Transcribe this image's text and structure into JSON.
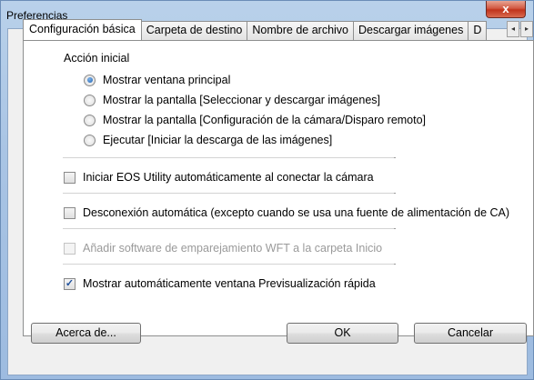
{
  "window": {
    "title": "Preferencias",
    "close_glyph": "x"
  },
  "tabs": [
    {
      "label": "Configuración básica"
    },
    {
      "label": "Carpeta de destino"
    },
    {
      "label": "Nombre de archivo"
    },
    {
      "label": "Descargar imágenes"
    },
    {
      "label": "D"
    }
  ],
  "tab_arrows": {
    "left": "◂",
    "right": "▸"
  },
  "initial_action": {
    "label": "Acción inicial",
    "options": [
      {
        "label": "Mostrar ventana principal",
        "selected": true
      },
      {
        "label": "Mostrar la pantalla [Seleccionar y descargar imágenes]",
        "selected": false
      },
      {
        "label": "Mostrar la pantalla [Configuración de la cámara/Disparo remoto]",
        "selected": false
      },
      {
        "label": "Ejecutar [Iniciar la descarga de las imágenes]",
        "selected": false
      }
    ]
  },
  "checks": [
    {
      "label": "Iniciar EOS Utility automáticamente al conectar la cámara",
      "checked": false,
      "enabled": true,
      "mark": ""
    },
    {
      "label": "Desconexión automática (excepto cuando se usa una fuente de alimentación de CA)",
      "checked": false,
      "enabled": true,
      "mark": ""
    },
    {
      "label": "Añadir software de emparejamiento WFT a la carpeta Inicio",
      "checked": false,
      "enabled": false,
      "mark": ""
    },
    {
      "label": "Mostrar automáticamente ventana Previsualización rápida",
      "checked": true,
      "enabled": true,
      "mark": "✓"
    }
  ],
  "buttons": {
    "about": "Acerca de...",
    "ok": "OK",
    "cancel": "Cancelar"
  }
}
